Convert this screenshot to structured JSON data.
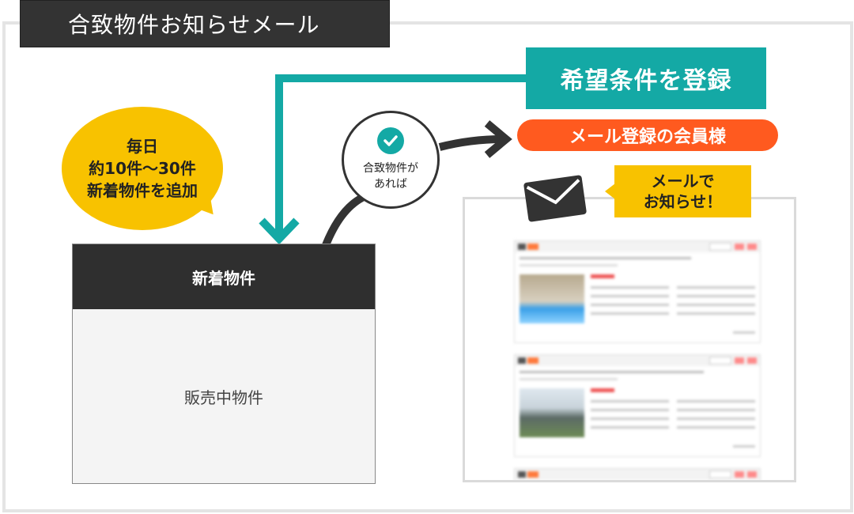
{
  "title": "合致物件お知らせメール",
  "register_label": "希望条件を登録",
  "member_label": "メール登録の会員様",
  "bubble_lines": [
    "毎日",
    "約10件〜30件",
    "新着物件を追加"
  ],
  "match_lines": [
    "合致物件が",
    "あれば"
  ],
  "listing_head": "新着物件",
  "listing_body": "販売中物件",
  "notify_lines": [
    "メールで",
    "お知らせ！"
  ],
  "icons": [
    "check-icon",
    "envelope-icon",
    "arrow-down-icon",
    "arrow-right-icon"
  ],
  "colors": {
    "teal": "#14a9a5",
    "orange": "#ff5a1f",
    "yellow": "#f8c200",
    "dark": "#333333"
  }
}
